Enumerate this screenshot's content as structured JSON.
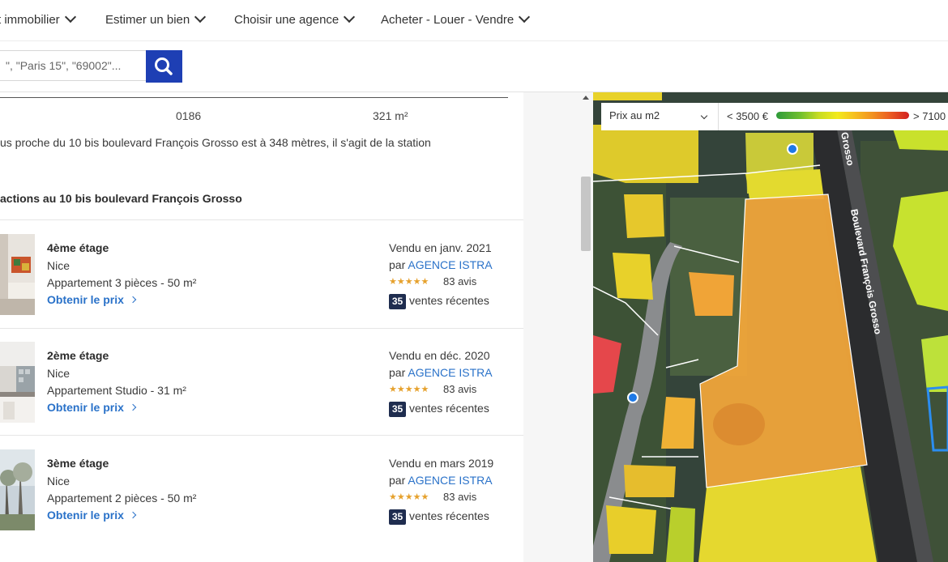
{
  "nav": {
    "items": [
      {
        "label": "t immobilier"
      },
      {
        "label": "Estimer un bien"
      },
      {
        "label": "Choisir une agence"
      },
      {
        "label": "Acheter - Louer - Vendre"
      }
    ]
  },
  "search": {
    "placeholder": "\", \"Paris 15\", \"69002\"..."
  },
  "summary": {
    "code": "0186",
    "surface": "321 m²",
    "transport_text": "us proche du 10 bis boulevard François Grosso est à 348 mètres, il s'agit de la station",
    "section_title": "actions au 10 bis boulevard François Grosso"
  },
  "transactions": [
    {
      "title": "4ème étage",
      "city": "Nice",
      "description": "Appartement 3 pièces - 50 m²",
      "link": "Obtenir le prix",
      "sold": "Vendu en janv. 2021",
      "agency_prefix": "par",
      "agency": "AGENCE ISTRA",
      "stars": "★★★★★",
      "reviews": "83 avis",
      "recent_count": "35",
      "recent_label": "ventes récentes"
    },
    {
      "title": "2ème étage",
      "city": "Nice",
      "description": "Appartement Studio - 31 m²",
      "link": "Obtenir le prix",
      "sold": "Vendu en déc. 2020",
      "agency_prefix": "par",
      "agency": "AGENCE ISTRA",
      "stars": "★★★★★",
      "reviews": "83 avis",
      "recent_count": "35",
      "recent_label": "ventes récentes"
    },
    {
      "title": "3ème étage",
      "city": "Nice",
      "description": "Appartement 2 pièces - 50 m²",
      "link": "Obtenir le prix",
      "sold": "Vendu en mars 2019",
      "agency_prefix": "par",
      "agency": "AGENCE ISTRA",
      "stars": "★★★★★",
      "reviews": "83 avis",
      "recent_count": "35",
      "recent_label": "ventes récentes"
    }
  ],
  "map": {
    "select_label": "Prix au m2",
    "legend_low": "< 3500 €",
    "legend_high": "> 7100",
    "street_label": "Boulevard François Grosso",
    "street_label_top": "Grosso"
  },
  "colors": {
    "accent": "#1e3fb4",
    "link": "#2a72c9",
    "badge": "#1f2d4f",
    "stars": "#e6a12d"
  },
  "icons": {
    "search": "search-icon",
    "chevron": "chevron-down-icon"
  }
}
